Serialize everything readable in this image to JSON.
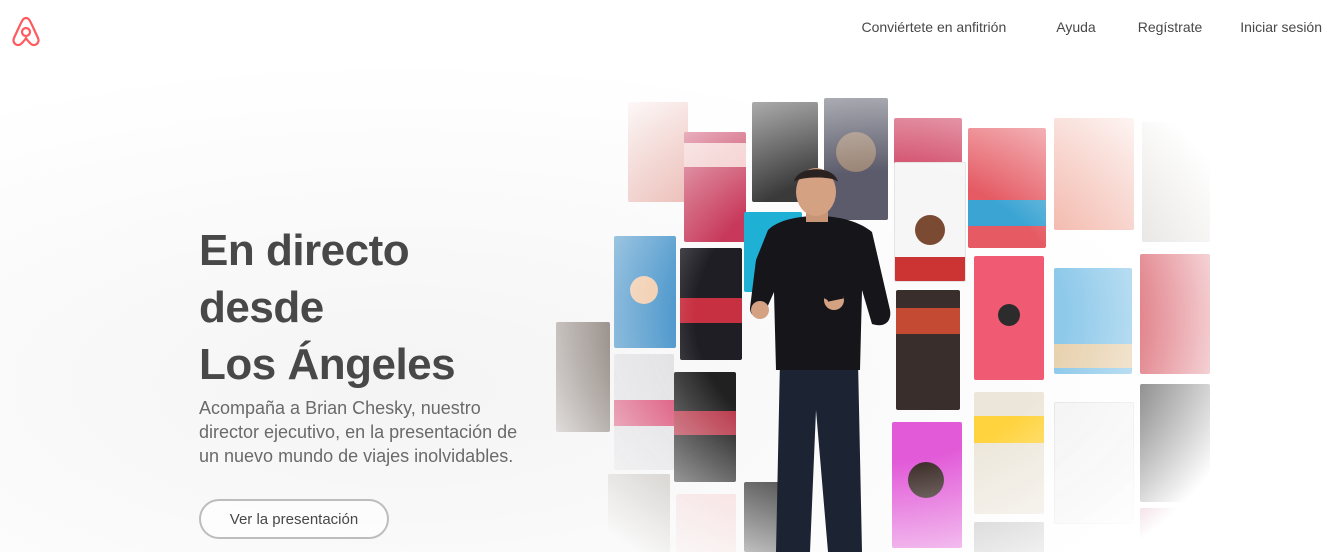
{
  "header": {
    "logo_icon": "airbnb-belo-logo",
    "brand_color": "#FF5A5F",
    "nav": {
      "host": "Conviértete en anfitrión",
      "help": "Ayuda",
      "signup": "Regístrate",
      "login": "Iniciar sesión"
    }
  },
  "hero": {
    "title_lines": [
      "En directo",
      "desde",
      "Los Ángeles"
    ],
    "subtitle": "Acompaña a Brian Chesky, nuestro director ejecutivo, en la presentación de un nuevo mundo de viajes inolvidables.",
    "cta_label": "Ver la presentación",
    "image": "speaker-on-stage-with-poster-wall"
  }
}
